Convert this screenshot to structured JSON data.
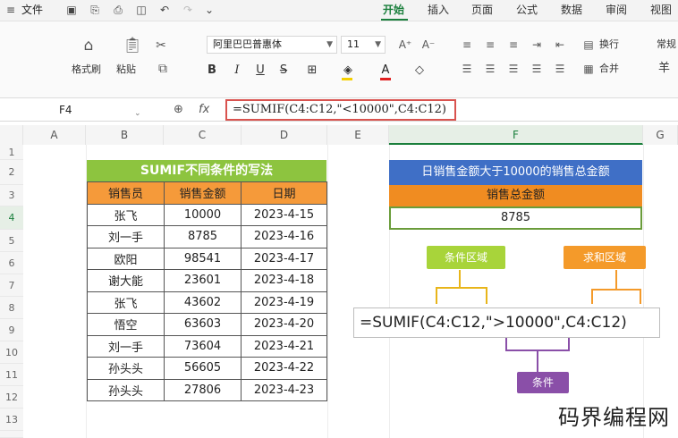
{
  "topbar": {
    "file_label": "文件",
    "tabs": [
      "开始",
      "插入",
      "页面",
      "公式",
      "数据",
      "审阅",
      "视图"
    ],
    "active_tab": "开始"
  },
  "ribbon": {
    "format_painter": "格式刷",
    "paste": "粘贴",
    "font_name": "阿里巴巴普惠体",
    "font_size": "11",
    "bold": "B",
    "italic": "I",
    "underline": "U",
    "strike": "S",
    "font_color_letter": "A",
    "wrap_text": "换行",
    "merge": "合并",
    "number_format": "常规",
    "currency_symbol": "羊"
  },
  "formula_bar": {
    "name_box": "F4",
    "fx": "fx",
    "formula": "=SUMIF(C4:C12,\"<10000\",C4:C12)"
  },
  "sheet": {
    "columns": [
      "A",
      "B",
      "C",
      "D",
      "E",
      "F",
      "G"
    ],
    "rows": [
      "1",
      "2",
      "3",
      "4",
      "5",
      "6",
      "7",
      "8",
      "9",
      "10",
      "11",
      "12",
      "13",
      "14"
    ],
    "selected_column": "F",
    "selected_row": "4"
  },
  "data_table": {
    "title": "SUMIF不同条件的写法",
    "headers": [
      "销售员",
      "销售金额",
      "日期"
    ],
    "rows": [
      [
        "张飞",
        "10000",
        "2023-4-15"
      ],
      [
        "刘一手",
        "8785",
        "2023-4-16"
      ],
      [
        "欧阳",
        "98541",
        "2023-4-17"
      ],
      [
        "谢大能",
        "23601",
        "2023-4-18"
      ],
      [
        "张飞",
        "43602",
        "2023-4-19"
      ],
      [
        "悟空",
        "63603",
        "2023-4-20"
      ],
      [
        "刘一手",
        "73604",
        "2023-4-21"
      ],
      [
        "孙头头",
        "56605",
        "2023-4-22"
      ],
      [
        "孙头头",
        "27806",
        "2023-4-23"
      ]
    ]
  },
  "result_block": {
    "title": "日销售金额大于10000的销售总金额",
    "header": "销售总金额",
    "value": "8785"
  },
  "annotation": {
    "tag_condition_range": "条件区域",
    "tag_sum_range": "求和区域",
    "tag_condition": "条件",
    "formula": "=SUMIF(C4:C12,\">10000\",C4:C12)"
  },
  "watermark": "码界编程网",
  "colors": {
    "accent": "#1a7f3c",
    "title_green": "#8dc43f",
    "header_orange": "#f59a3a",
    "result_blue": "#3f6fc6",
    "formula_border": "#d9534f",
    "tag_purple": "#8a4fa8"
  }
}
